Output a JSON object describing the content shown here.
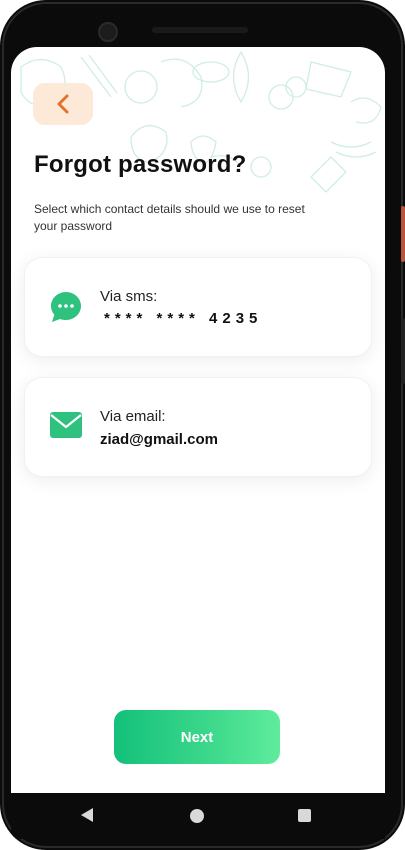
{
  "header": {
    "back_icon": "chevron-left-icon",
    "title": "Forgot password?",
    "subtitle": "Select which contact details should we use to reset your password"
  },
  "options": [
    {
      "icon": "chat-bubble-icon",
      "label": "Via sms:",
      "value": "**** **** 4235"
    },
    {
      "icon": "mail-icon",
      "label": "Via email:",
      "value": "ziad@gmail.com"
    }
  ],
  "actions": {
    "next_label": "Next"
  },
  "colors": {
    "accent_green": "#13c07a",
    "back_button_bg": "#fde9d8",
    "back_chevron": "#e07430"
  },
  "system_nav": [
    "back-icon",
    "home-icon",
    "recents-icon"
  ]
}
